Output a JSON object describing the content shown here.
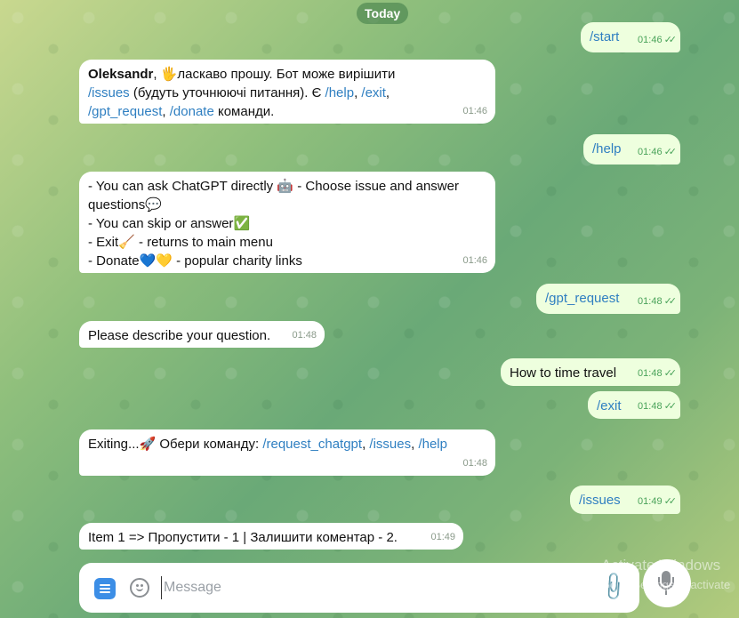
{
  "date_divider": "Today",
  "messages": [
    {
      "dir": "out",
      "text": "/start",
      "time": "01:46"
    },
    {
      "dir": "in",
      "author": "Oleksandr",
      "time": "01:46",
      "intro_after_name": ", ",
      "greet": "ласкаво прошу. Бот може вирішити",
      "cmd_issues": "/issues",
      "clarify": " (будуть уточнюючі питання). Є ",
      "cmd_help": "/help",
      "sep1": ", ",
      "cmd_exit": "/exit",
      "sep2": ",",
      "cmd_gpt": "/gpt_request",
      "sep3": ", ",
      "cmd_donate": "/donate",
      "tail": " команди."
    },
    {
      "dir": "out",
      "text": "/help",
      "time": "01:46"
    },
    {
      "dir": "in",
      "time": "01:46",
      "line1a": "- You can ask ChatGPT directly ",
      "line1b": " - Choose issue and answer",
      "line2": "questions",
      "line3": " - You can skip or answer",
      "line4a": " - Exit",
      "line4b": " - returns to main menu",
      "line5a": " - Donate",
      "line5b": " - popular charity links"
    },
    {
      "dir": "out",
      "text": "/gpt_request",
      "time": "01:48"
    },
    {
      "dir": "in",
      "text": "Please describe your question.",
      "time": "01:48"
    },
    {
      "dir": "out",
      "text": "How to time travel",
      "time": "01:48"
    },
    {
      "dir": "out",
      "text": "/exit",
      "time": "01:48"
    },
    {
      "dir": "in",
      "time": "01:48",
      "prefix": "Exiting...",
      "mid": " Обери команду: ",
      "cmd1": "/request_chatgpt",
      "sep1": ", ",
      "cmd2": "/issues",
      "sep2": ", ",
      "cmd3": "/help"
    },
    {
      "dir": "out",
      "text": "/issues",
      "time": "01:49"
    },
    {
      "dir": "in",
      "text": "Item 1 => Пропустити - 1  | Залишити коментар - 2.",
      "time": "01:49"
    }
  ],
  "emoji": {
    "wave": "🖐",
    "robot": "🤖",
    "speech": "💬",
    "check": "✅",
    "broom": "🧹",
    "blue_heart": "💙",
    "yellow_heart": "💛",
    "rocket": "🚀"
  },
  "read_receipt": "✓✓",
  "composer": {
    "placeholder": "Message",
    "menu_icon": "menu-icon",
    "emoji_icon": "smile-icon",
    "attach_icon": "paperclip-icon",
    "mic_icon": "microphone-icon"
  },
  "watermark": {
    "title": "Activate Windows",
    "subtitle": "Go to Settings to activate"
  },
  "colors": {
    "link": "#2f7fc1",
    "outgoing_bubble": "#eeffde",
    "incoming_bubble": "#ffffff",
    "check": "#4aa35a",
    "menu_button": "#3c8ee6"
  }
}
